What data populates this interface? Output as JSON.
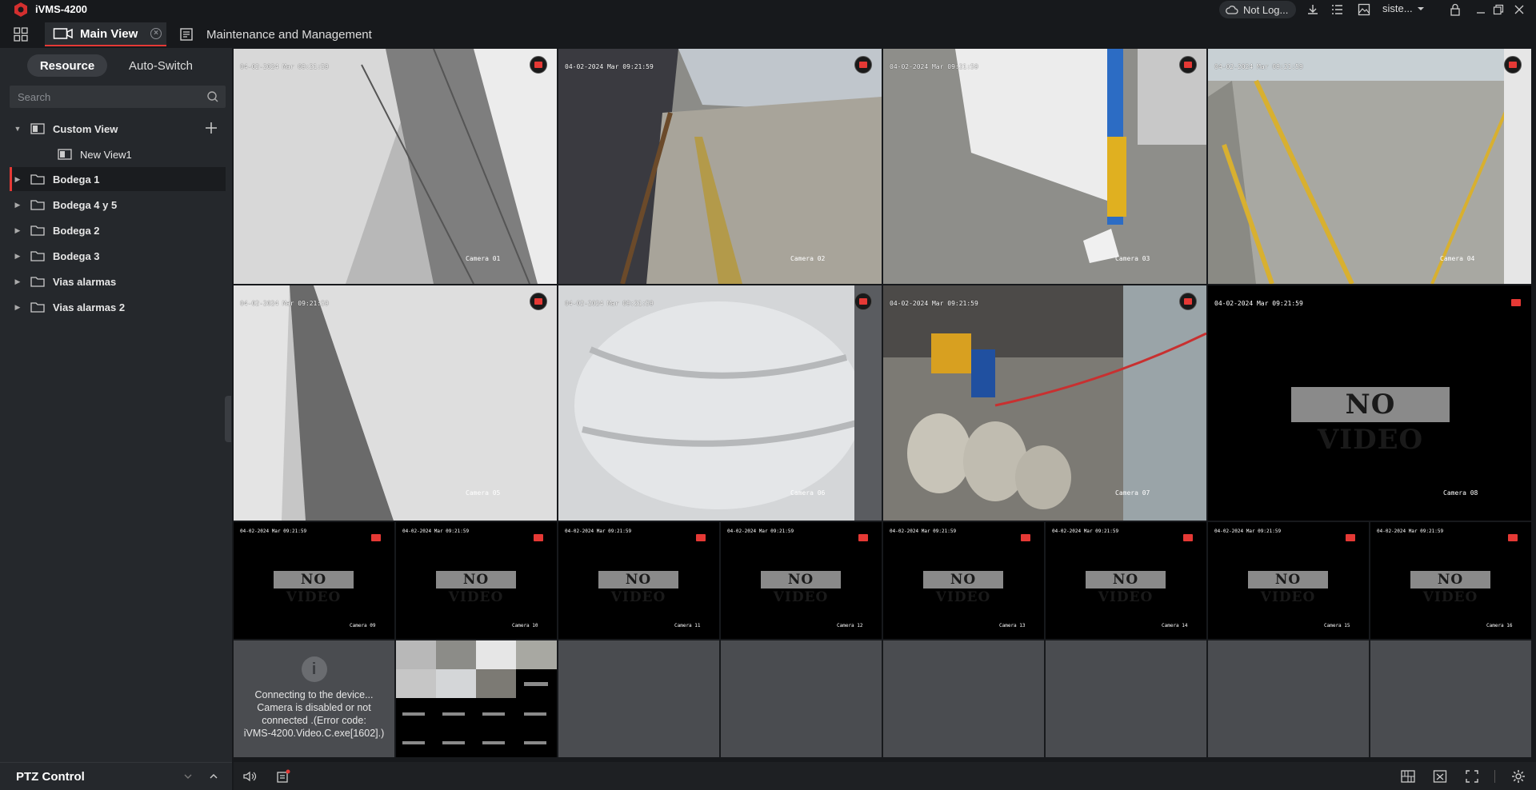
{
  "app": {
    "title": "iVMS-4200"
  },
  "tabs": {
    "main_view": "Main View",
    "maintenance": "Maintenance and Management"
  },
  "header": {
    "not_logged": "Not Log...",
    "user": "siste..."
  },
  "sidebar": {
    "resource_tab": "Resource",
    "auto_switch_tab": "Auto-Switch",
    "search_placeholder": "Search",
    "custom_view": "Custom View",
    "new_view": "New View1",
    "groups": [
      "Bodega 1",
      "Bodega 4 y 5",
      "Bodega 2",
      "Bodega 3",
      "Vias alarmas",
      "Vias alarmas 2"
    ],
    "ptz": "PTZ Control"
  },
  "cameras": {
    "timestamp": "04-02-2024 Mar 09:21:59",
    "no_video": "NO VIDEO",
    "names": [
      "Camera 01",
      "Camera 02",
      "Camera 03",
      "Camera 04",
      "Camera 05",
      "Camera 06",
      "Camera 07",
      "Camera 08"
    ],
    "small_ts": "04-02-2024 Mar 09:21:59",
    "small_names": [
      "Camera 09",
      "Camera 10",
      "Camera 11",
      "Camera 12",
      "Camera 13",
      "Camera 14",
      "Camera 15",
      "Camera 16"
    ]
  },
  "error": {
    "line1": "Connecting to the device...",
    "line2": "Camera is disabled or not",
    "line3": "connected .(Error code:",
    "line4": "iVMS-4200.Video.C.exe[1602].)"
  },
  "colors": {
    "accent": "#e53935",
    "background": "#17191c",
    "panel": "#25282c"
  }
}
